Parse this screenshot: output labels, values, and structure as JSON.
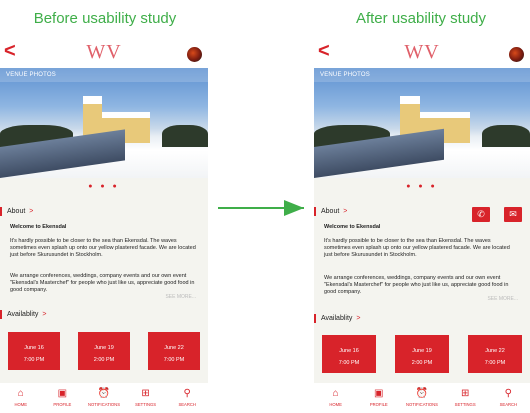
{
  "captions": {
    "before": "Before usability study",
    "after": "After usability study"
  },
  "app": {
    "logo": "WV",
    "back_symbol": "<",
    "venue_photos": "VENUE PHOTOS",
    "dots": "● ● ●",
    "about": {
      "title": "About",
      "chevron": ">",
      "heading": "Welcome to Ekensdal",
      "paragraph1": "It's hardly possible to be closer to the sea than Ekensdal. The waves sometimes even splash up onto our yellow plastered facade. We are located just before Skurusundet in Stockholm.",
      "paragraph2": "We arrange conferences, weddings, company events and our own event \"Ekensdal's Masterchef\" for people who just like us, appreciate good food in good company.",
      "see_more": "SEE MORE..."
    },
    "availability": {
      "title_before": "Availablity",
      "title_after": "Availablity",
      "chevron": ">",
      "slots": [
        {
          "date": "June 16",
          "time": "7:00 PM"
        },
        {
          "date": "June 19",
          "time": "2:00 PM"
        },
        {
          "date": "June 22",
          "time": "7:00 PM"
        }
      ]
    },
    "tabs": [
      {
        "icon": "home-icon",
        "glyph": "⌂",
        "label": "HOME"
      },
      {
        "icon": "profile-icon",
        "glyph": "▣",
        "label": "PROFILE"
      },
      {
        "icon": "notifications-icon",
        "glyph": "⏰",
        "label": "NOTIFICATIONS"
      },
      {
        "icon": "settings-icon",
        "glyph": "⊞",
        "label": "SETTINGS"
      },
      {
        "icon": "search-icon",
        "glyph": "⚲",
        "label": "SEARCH"
      }
    ],
    "actions": {
      "call_glyph": "✆",
      "message_glyph": "✉"
    }
  },
  "colors": {
    "accent": "#d8232a",
    "caption_green": "#3fae49",
    "logo_pink": "#e0606a",
    "background": "#f4f4ef"
  }
}
